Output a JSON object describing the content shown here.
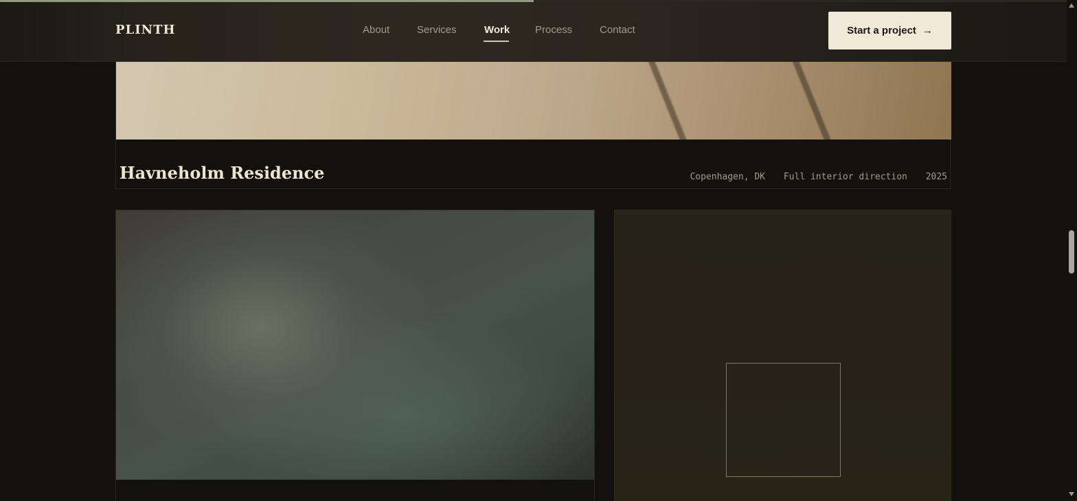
{
  "scroll_progress": 0.5,
  "header": {
    "logo": "PLINTH",
    "nav": [
      {
        "label": "About",
        "active": false
      },
      {
        "label": "Services",
        "active": false
      },
      {
        "label": "Work",
        "active": true
      },
      {
        "label": "Process",
        "active": false
      },
      {
        "label": "Contact",
        "active": false
      }
    ],
    "cta_label": "Start a project",
    "cta_arrow": "→"
  },
  "featured_project": {
    "title": "Havneholm Residence",
    "location": "Copenhagen, DK",
    "scope": "Full interior direction",
    "year": "2025"
  },
  "icons": {
    "cta": "arrow-right-icon",
    "scroll_up": "triangle-up-icon",
    "scroll_down": "triangle-down-icon"
  },
  "colors": {
    "background": "#12110d",
    "accent": "#f1e9d8",
    "progress": "#8f9a80"
  }
}
